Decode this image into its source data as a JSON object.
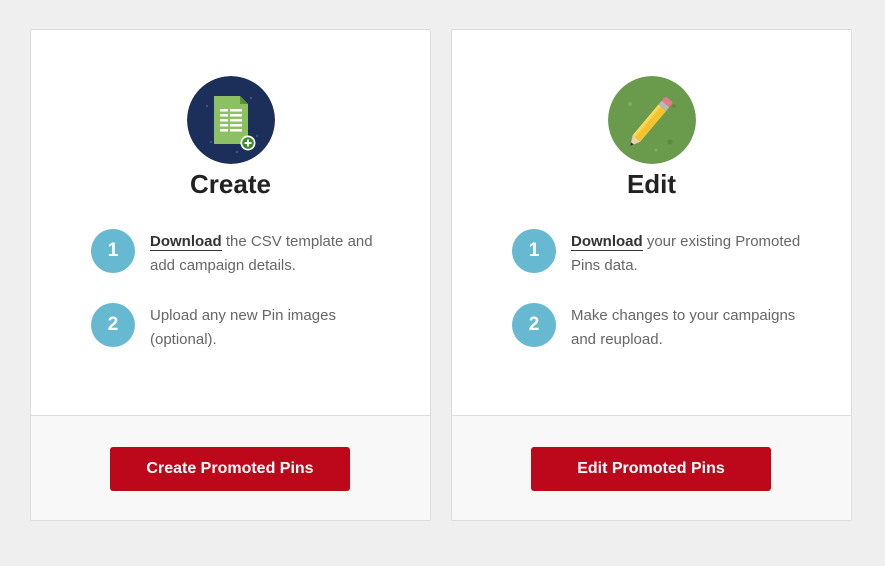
{
  "cards": [
    {
      "icon": "csv-spreadsheet-add-icon",
      "title": "Create",
      "steps": [
        {
          "number": "1",
          "link": "Download",
          "text": " the CSV template and add campaign details."
        },
        {
          "number": "2",
          "link": "",
          "text": "Upload any new Pin images (optional)."
        }
      ],
      "button_label": "Create Promoted Pins"
    },
    {
      "icon": "pencil-edit-icon",
      "title": "Edit",
      "steps": [
        {
          "number": "1",
          "link": "Download",
          "text": " your existing Promoted Pins data."
        },
        {
          "number": "2",
          "link": "",
          "text": "Make changes to your campaigns and reupload."
        }
      ],
      "button_label": "Edit Promoted Pins"
    }
  ],
  "colors": {
    "button_red": "#bd081c",
    "step_blue": "#67b8d1",
    "create_icon_bg": "#1c2f5a",
    "edit_icon_bg": "#6a9a4c"
  }
}
